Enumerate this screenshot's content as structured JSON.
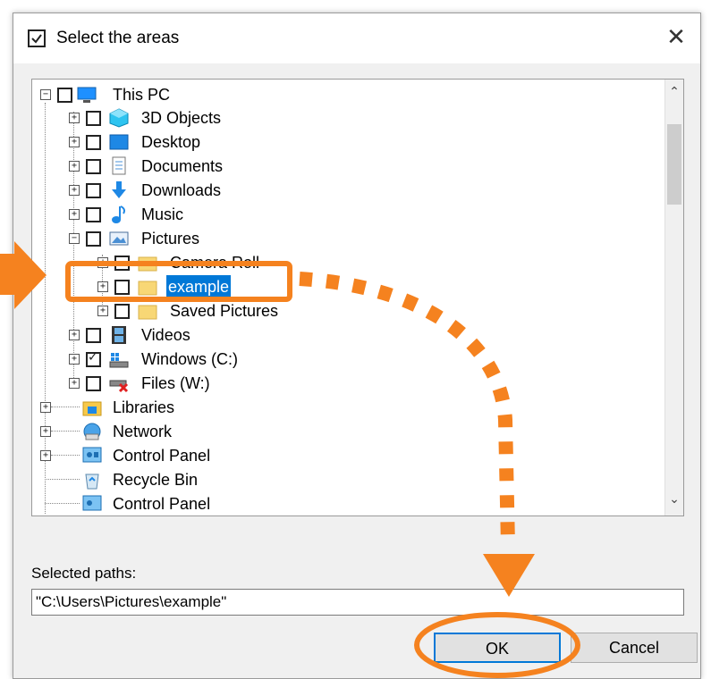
{
  "dialog": {
    "title": "Select the areas",
    "close_glyph": "✕"
  },
  "tree": {
    "items": [
      {
        "label": "This PC",
        "icon": "computer-icon",
        "expander": "⊟",
        "checked": false
      },
      {
        "label": "3D Objects",
        "icon": "3d-objects-icon",
        "expander": "⊞",
        "checked": false
      },
      {
        "label": "Desktop",
        "icon": "desktop-icon",
        "expander": "⊞",
        "checked": false
      },
      {
        "label": "Documents",
        "icon": "documents-icon",
        "expander": "⊞",
        "checked": false
      },
      {
        "label": "Downloads",
        "icon": "downloads-icon",
        "expander": "⊞",
        "checked": false
      },
      {
        "label": "Music",
        "icon": "music-icon",
        "expander": "⊞",
        "checked": false
      },
      {
        "label": "Pictures",
        "icon": "pictures-icon",
        "expander": "⊟",
        "checked": false
      },
      {
        "label": "Camera Roll",
        "icon": "folder-icon",
        "expander": "⊞",
        "checked": false
      },
      {
        "label": "example",
        "icon": "folder-icon",
        "expander": "⊞",
        "checked": false,
        "selected": true
      },
      {
        "label": "Saved Pictures",
        "icon": "folder-icon",
        "expander": "⊞",
        "checked": false
      },
      {
        "label": "Videos",
        "icon": "videos-icon",
        "expander": "⊞",
        "checked": false
      },
      {
        "label": "Windows (C:)",
        "icon": "drive-icon",
        "expander": "⊞",
        "checked": true
      },
      {
        "label": "Files (W:)",
        "icon": "network-drive-icon",
        "expander": "⊞",
        "checked": false
      },
      {
        "label": "Libraries",
        "icon": "libraries-icon",
        "expander": "⊞"
      },
      {
        "label": "Network",
        "icon": "network-icon",
        "expander": "⊞"
      },
      {
        "label": "Control Panel",
        "icon": "control-panel-icon",
        "expander": "⊞"
      },
      {
        "label": "Recycle Bin",
        "icon": "recycle-bin-icon",
        "expander": ""
      },
      {
        "label": "Control Panel",
        "icon": "control-panel-icon",
        "expander": ""
      }
    ],
    "scroll_up": "⌃",
    "scroll_down": "⌄"
  },
  "selected_paths": {
    "label": "Selected paths:",
    "value": "\"C:\\Users\\Pictures\\example\""
  },
  "buttons": {
    "ok": "OK",
    "cancel": "Cancel"
  },
  "colors": {
    "annotation": "#f5821f",
    "selection": "#0078d7"
  }
}
